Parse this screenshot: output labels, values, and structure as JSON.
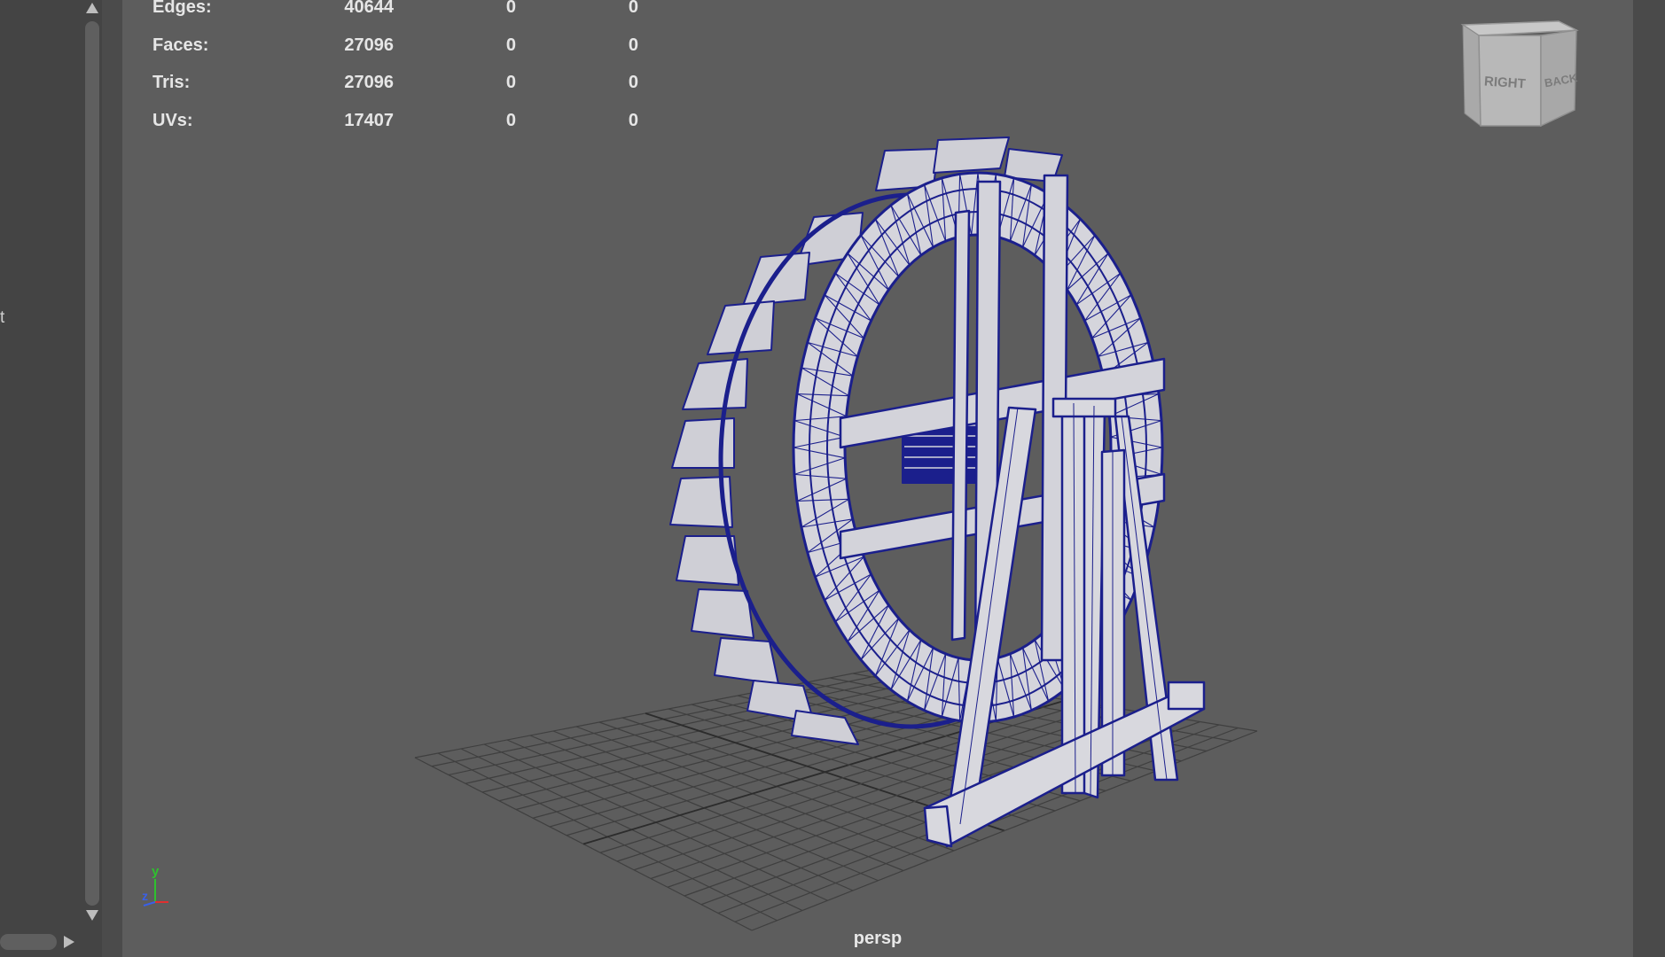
{
  "outliner": {
    "partial_text": "t"
  },
  "hud": {
    "rows": [
      {
        "label": "Edges:",
        "v1": "40644",
        "v2": "0",
        "v3": "0"
      },
      {
        "label": "Faces:",
        "v1": "27096",
        "v2": "0",
        "v3": "0"
      },
      {
        "label": "Tris:",
        "v1": "27096",
        "v2": "0",
        "v3": "0"
      },
      {
        "label": "UVs:",
        "v1": "17407",
        "v2": "0",
        "v3": "0"
      }
    ]
  },
  "viewcube": {
    "right_label": "RIGHT",
    "back_label": "BACK"
  },
  "axis_indicator": {
    "y_label": "y",
    "z_label": "z"
  },
  "camera": {
    "name": "persp"
  },
  "colors": {
    "viewport_bg": "#5d5d5d",
    "wireframe": "#1b1f8c",
    "mesh_fill": "#d7d7dc",
    "grid": "#3e3e3e"
  },
  "icons": [
    "scroll-up-arrow-icon",
    "scroll-down-arrow-icon",
    "scroll-right-arrow-icon",
    "axis-gizmo-icon",
    "viewcube-icon"
  ]
}
